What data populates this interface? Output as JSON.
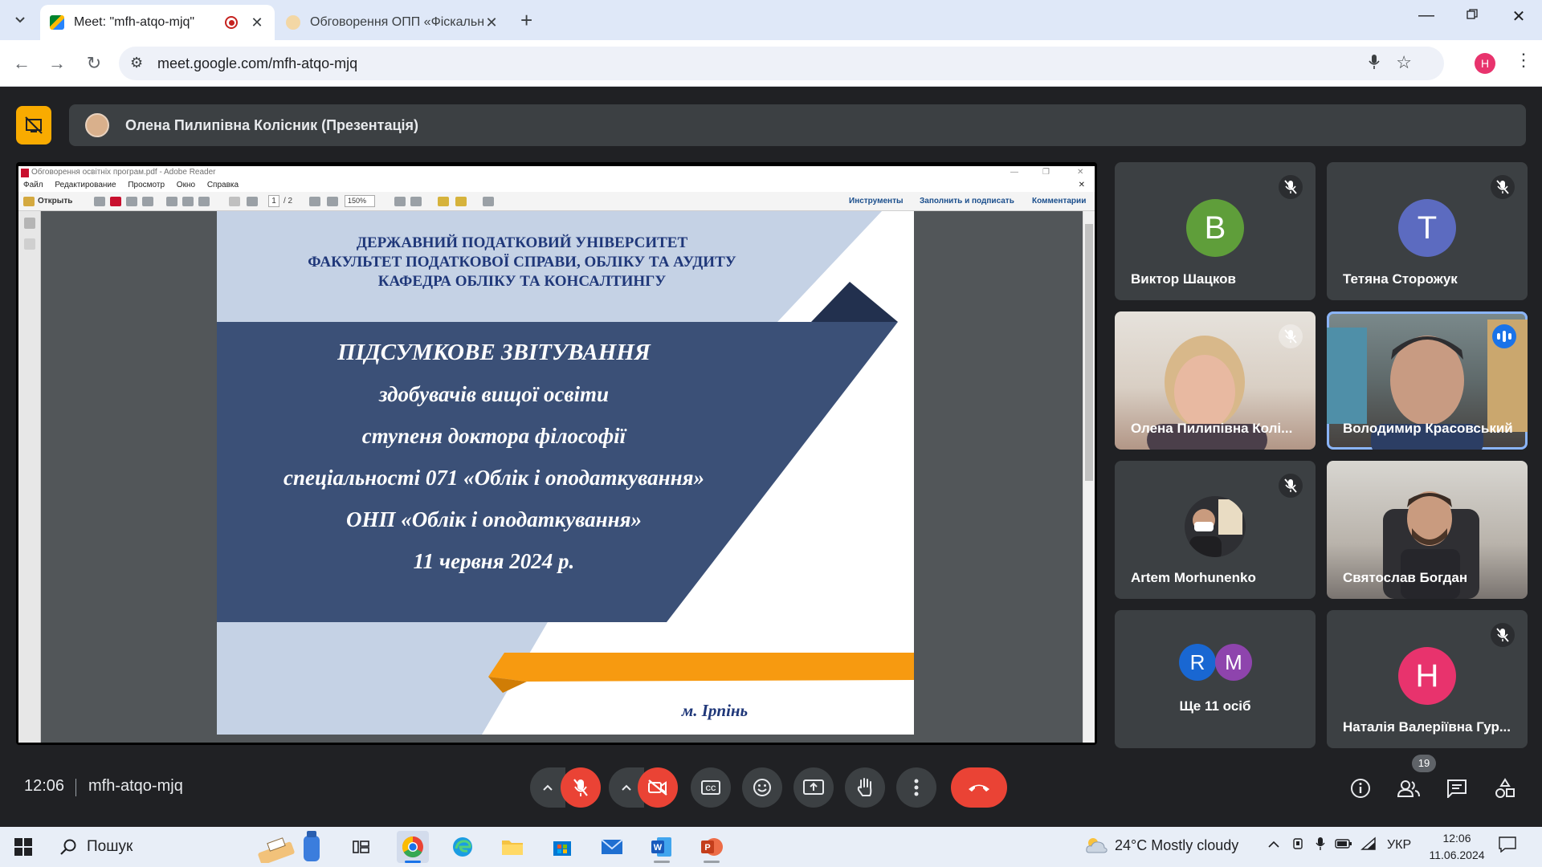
{
  "browser": {
    "tabs": [
      {
        "title": "Meet: \"mfh-atqo-mjq\"",
        "active": true
      },
      {
        "title": "Обговорення ОПП «Фіскальне",
        "active": false
      }
    ],
    "url": "meet.google.com/mfh-atqo-mjq",
    "profile_initial": "Н"
  },
  "meet": {
    "presenter_label": "Олена Пилипівна Колісник (Презентація)",
    "time": "12:06",
    "meeting_code": "mfh-atqo-mjq",
    "participants_count": "19",
    "participants": [
      {
        "name": "Виктор Шацков",
        "initial": "В",
        "color": "#5f9e3a",
        "muted": true
      },
      {
        "name": "Тетяна Сторожук",
        "initial": "Т",
        "color": "#5c6bc0",
        "muted": true
      },
      {
        "name": "Олена Пилипівна Колі...",
        "muted": true
      },
      {
        "name": "Володимир Красовський",
        "speaking": true
      },
      {
        "name": "Artem Morhunenko",
        "muted": true
      },
      {
        "name": "Святослав Богдан"
      },
      {
        "name": "Ще 11 осіб",
        "initials": [
          "R",
          "M"
        ]
      },
      {
        "name": "Наталія Валеріївна Гур...",
        "initial": "Н",
        "color": "#e8336d",
        "muted": true
      }
    ]
  },
  "reader": {
    "window_title": "Обговорення освітніх програм.pdf - Adobe Reader",
    "menu": [
      "Файл",
      "Редактирование",
      "Просмотр",
      "Окно",
      "Справка"
    ],
    "open_label": "Открыть",
    "page_current": "1",
    "page_total": "/ 2",
    "zoom": "150%",
    "tools": [
      "Инструменты",
      "Заполнить и подписать",
      "Комментарии"
    ]
  },
  "slide": {
    "header_lines": [
      "ДЕРЖАВНИЙ ПОДАТКОВИЙ УНІВЕРСИТЕТ",
      "ФАКУЛЬТЕТ ПОДАТКОВОЇ СПРАВИ, ОБЛІКУ ТА АУДИТУ",
      "КАФЕДРА ОБЛІКУ ТА КОНСАЛТИНГУ"
    ],
    "main_lines": [
      "ПІДСУМКОВЕ ЗВІТУВАННЯ",
      "здобувачів вищої освіти",
      "ступеня доктора філософії",
      "спеціальності 071 «Облік і оподаткування»",
      "ОНП «Облік і оподаткування»",
      "11 червня 2024 р."
    ],
    "city": "м. Ірпінь"
  },
  "taskbar": {
    "search_placeholder": "Пошук",
    "weather": "24°C  Mostly cloudy",
    "lang": "УКР",
    "time": "12:06",
    "date": "11.06.2024"
  }
}
